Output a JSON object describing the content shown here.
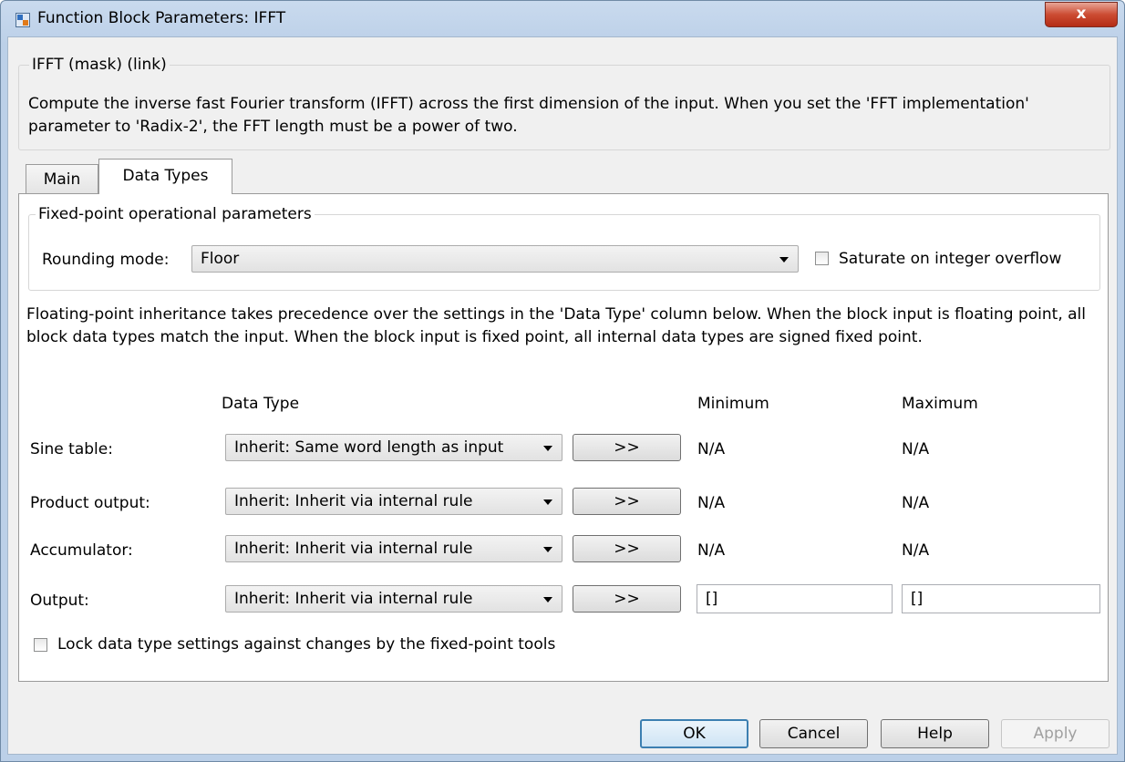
{
  "window": {
    "title": "Function Block Parameters: IFFT",
    "close_glyph": "x"
  },
  "mask": {
    "title": "IFFT (mask) (link)",
    "description": "Compute the inverse fast Fourier transform (IFFT) across the first dimension of the input. When you set the 'FFT implementation' parameter to 'Radix-2', the FFT length must be a power of two."
  },
  "tabs": [
    {
      "label": "Main",
      "active": false
    },
    {
      "label": "Data Types",
      "active": true
    }
  ],
  "fixed_point": {
    "group_title": "Fixed-point operational parameters",
    "rounding_label": "Rounding mode:",
    "rounding_value": "Floor",
    "saturate_label": "Saturate on integer overflow",
    "saturate_checked": false
  },
  "inheritance_note": "Floating-point inheritance takes precedence over the settings in the 'Data Type' column below. When the block input is floating point, all block data types match the input. When the block input is fixed point, all internal data types are signed fixed point.",
  "columns": {
    "data_type": "Data Type",
    "minimum": "Minimum",
    "maximum": "Maximum"
  },
  "rows": [
    {
      "label": "Sine table:",
      "data_type": "Inherit: Same word length as input",
      "button": ">>",
      "minimum": "N/A",
      "maximum": "N/A"
    },
    {
      "label": "Product output:",
      "data_type": "Inherit: Inherit via internal rule",
      "button": ">>",
      "minimum": "N/A",
      "maximum": "N/A"
    },
    {
      "label": "Accumulator:",
      "data_type": "Inherit: Inherit via internal rule",
      "button": ">>",
      "minimum": "N/A",
      "maximum": "N/A"
    },
    {
      "label": "Output:",
      "data_type": "Inherit: Inherit via internal rule",
      "button": ">>",
      "minimum": "[]",
      "maximum": "[]"
    }
  ],
  "lock": {
    "label": "Lock data type settings against changes by the fixed-point tools",
    "checked": false
  },
  "buttons": {
    "ok": "OK",
    "cancel": "Cancel",
    "help": "Help",
    "apply": "Apply"
  }
}
